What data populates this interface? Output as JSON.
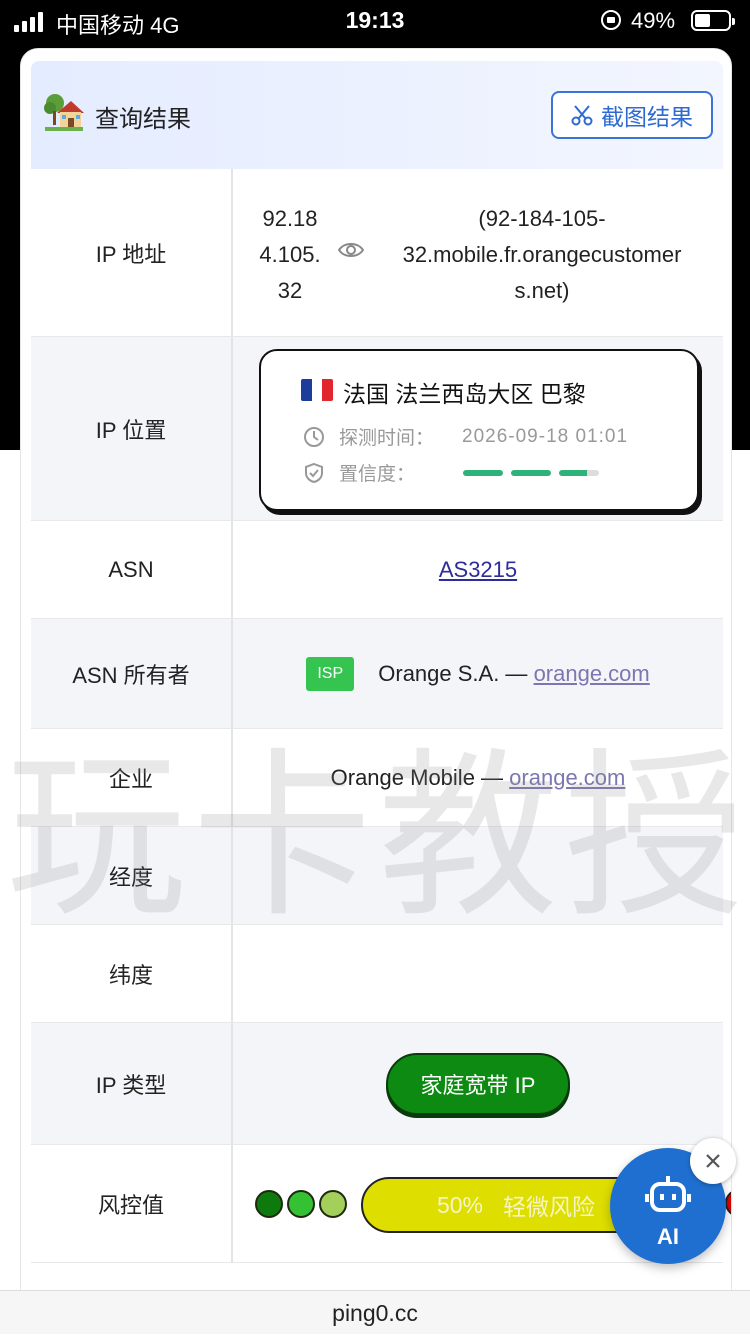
{
  "status_bar": {
    "carrier": "中国移动 4G",
    "time": "19:13",
    "battery": "49%"
  },
  "header": {
    "icon": "house-icon",
    "title": "查询结果",
    "capture_label": "截图结果"
  },
  "rows": {
    "ip": {
      "label": "IP 地址",
      "address": "92.184.105.32",
      "address_lines": [
        "92.18",
        "4.105.",
        "32"
      ],
      "reverse_dns": "(92-184-105-32.mobile.fr.orangecustomers.net)",
      "reverse_dns_lines": [
        "(92-184-105-",
        "32.mobile.fr.orangecustomer",
        "s.net)"
      ]
    },
    "location": {
      "label": "IP 位置",
      "country_flag": "FR",
      "place": "法国 法兰西岛大区 巴黎",
      "probe_label": "探测时间：",
      "probe_time": "2026-09-18 01:01",
      "confidence_label": "置信度：",
      "confidence_level": 0.8
    },
    "asn": {
      "label": "ASN",
      "value": "AS3215"
    },
    "asn_owner": {
      "label": "ASN 所有者",
      "badge": "ISP",
      "name": "Orange S.A. —",
      "link": "orange.com"
    },
    "org": {
      "label": "企业",
      "name": "Orange Mobile —",
      "link": "orange.com"
    },
    "longitude": {
      "label": "经度",
      "value": ""
    },
    "latitude": {
      "label": "纬度",
      "value": ""
    },
    "ip_type": {
      "label": "IP 类型",
      "value": "家庭宽带 IP"
    },
    "risk": {
      "label": "风控值",
      "percent": "50%",
      "level": "轻微风险",
      "level_value": 0.5
    }
  },
  "watermark": "玩卡教授",
  "ai_button": {
    "label": "AI"
  },
  "url_bar": {
    "domain": "ping0.cc"
  },
  "colors": {
    "accent": "#2d6bd2",
    "confidence": "#2db27a",
    "ip_type_bg": "#0c8a12",
    "risk_bar": "#dede00",
    "ai_button": "#1f6fd0"
  }
}
